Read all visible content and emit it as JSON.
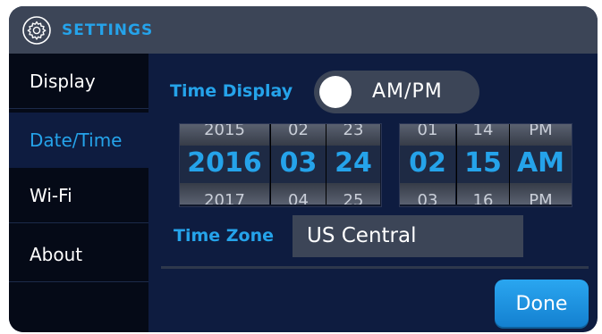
{
  "header": {
    "title": "SETTINGS",
    "icon": "gear-icon"
  },
  "sidebar": {
    "items": [
      {
        "label": "Display",
        "active": false
      },
      {
        "label": "Date/Time",
        "active": true
      },
      {
        "label": "Wi-Fi",
        "active": false
      },
      {
        "label": "About",
        "active": false
      }
    ]
  },
  "time_display": {
    "label": "Time Display",
    "value": "AM/PM"
  },
  "date_picker": {
    "year": {
      "prev": "2015",
      "selected": "2016",
      "next": "2017"
    },
    "month": {
      "prev": "02",
      "selected": "03",
      "next": "04"
    },
    "day": {
      "prev": "23",
      "selected": "24",
      "next": "25"
    }
  },
  "time_picker": {
    "hour": {
      "prev": "01",
      "selected": "02",
      "next": "03"
    },
    "minute": {
      "prev": "14",
      "selected": "15",
      "next": "16"
    },
    "ampm": {
      "prev": "PM",
      "selected": "AM",
      "next": "PM"
    }
  },
  "time_zone": {
    "label": "Time Zone",
    "value": "US Central"
  },
  "footer": {
    "done_label": "Done"
  },
  "colors": {
    "accent": "#25a3ea",
    "panel": "#0e1c40",
    "sidebar": "#050a17",
    "field": "#3c4557"
  }
}
